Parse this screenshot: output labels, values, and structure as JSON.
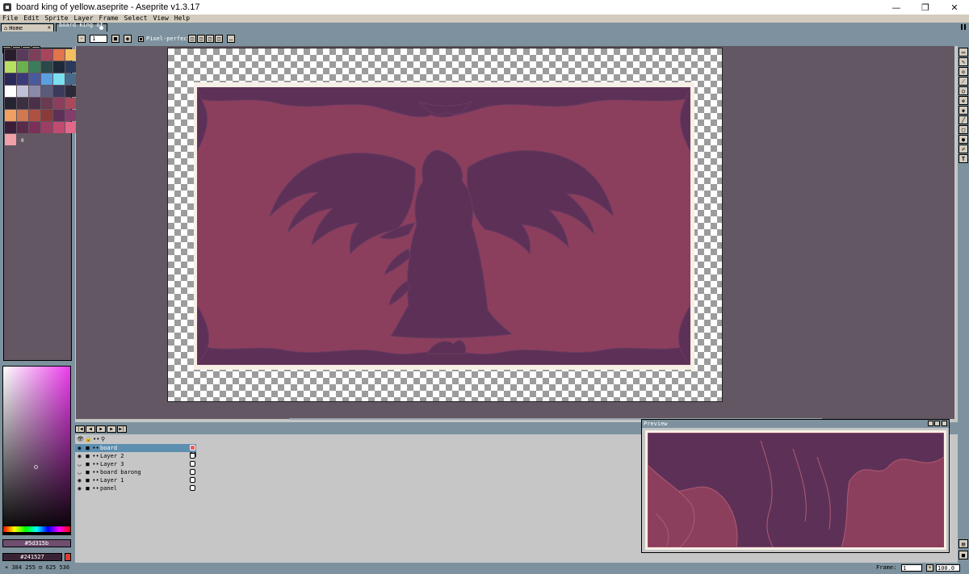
{
  "window": {
    "title": "board king of yellow.aseprite - Aseprite v1.3.17",
    "controls": {
      "minimize": "—",
      "restore": "❐",
      "close": "✕"
    }
  },
  "menu": [
    "File",
    "Edit",
    "Sprite",
    "Layer",
    "Frame",
    "Select",
    "View",
    "Help"
  ],
  "tabs": {
    "home": {
      "label": "Home",
      "close": "✕",
      "icon": "home-icon"
    },
    "file": {
      "label": "board king of ..."
    }
  },
  "context_bar": {
    "brush_size": "1",
    "pixel_perfect_label": "Pixel-perfect"
  },
  "palette": {
    "colors": [
      "#2a1d2c",
      "#5a3a5a",
      "#7d3f58",
      "#a8455a",
      "#e0744a",
      "#f2c062",
      "#b8e060",
      "#6ab04c",
      "#3a7d5a",
      "#2a4a4a",
      "#1e2a3a",
      "#2a3a5a",
      "#2a2a5a",
      "#3a3a7a",
      "#4a5aa0",
      "#5aa0e0",
      "#7ae0f0",
      "#4a6a8a",
      "#ffffff",
      "#c0c0d8",
      "#8a8aa8",
      "#5a5a7a",
      "#3a3a5a",
      "#2a2a3a",
      "#242432",
      "#3a3040",
      "#4a3048",
      "#6a3a50",
      "#8c3f5d",
      "#a84a5a",
      "#f0a060",
      "#d07850",
      "#b05040",
      "#8a3a38",
      "#5d3157",
      "#843d6a",
      "#3a1e3a",
      "#5a2a4a",
      "#7a3058",
      "#9c3e62",
      "#c04a70",
      "#e06888",
      "#f0a0a8"
    ],
    "page_indicator": "0"
  },
  "color_picker": {
    "fg_hex": "#5d315b",
    "bg_hex": "#241527",
    "fg_color": "#5d315b",
    "bg_color": "#241527"
  },
  "layers": {
    "header_frame": "1",
    "rows": [
      {
        "name": "board",
        "visible": true,
        "active": true
      },
      {
        "name": "Layer 2",
        "visible": true,
        "active": false
      },
      {
        "name": "Layer 3",
        "visible": false,
        "active": false
      },
      {
        "name": "board barong",
        "visible": false,
        "active": false
      },
      {
        "name": "Layer 1",
        "visible": true,
        "active": false
      },
      {
        "name": "panel",
        "visible": true,
        "active": false
      }
    ]
  },
  "preview": {
    "title": "Preview"
  },
  "status": {
    "coords": "384 255",
    "size": "625 536",
    "frame_label": "Frame:",
    "frame_value": "1",
    "zoom": "100.0"
  },
  "colors": {
    "board_fill": "#8c3f5d",
    "board_art": "#5d3157",
    "board_frame": "#f7efe6",
    "workspace": "#625762",
    "panel": "#7d929e",
    "accent_active": "#5d8fb0"
  }
}
